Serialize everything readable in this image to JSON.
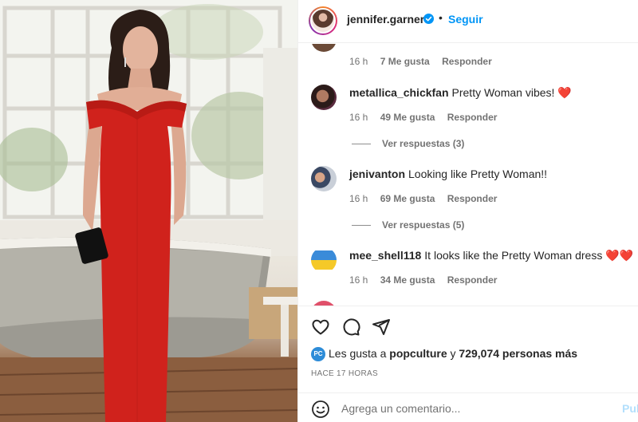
{
  "post": {
    "username": "jennifer.garner",
    "follow_label": "Seguir",
    "separator": "•"
  },
  "comments": {
    "top_meta": {
      "time": "16 h",
      "likes": "7 Me gusta",
      "reply": "Responder"
    },
    "items": [
      {
        "username": "metallica_chickfan",
        "text": "Pretty Woman vibes! ❤️",
        "time": "16 h",
        "likes": "49 Me gusta",
        "reply": "Responder",
        "replies": "Ver respuestas (3)"
      },
      {
        "username": "jenivanton",
        "text": "Looking like Pretty Woman!!",
        "time": "16 h",
        "likes": "69 Me gusta",
        "reply": "Responder",
        "replies": "Ver respuestas (5)"
      },
      {
        "username": "mee_shell118",
        "text": "It looks like the Pretty Woman dress ❤️❤️",
        "time": "16 h",
        "likes": "34 Me gusta",
        "reply": "Responder"
      }
    ]
  },
  "actions": {
    "like_icon": "heart-icon",
    "comment_icon": "comment-icon",
    "share_icon": "send-icon"
  },
  "likes": {
    "badge": "PC",
    "prefix": "Les gusta a",
    "user": "popculture",
    "connector": "y",
    "others": "729,074 personas más"
  },
  "timestamp": "HACE 17 HORAS",
  "add_comment": {
    "placeholder": "Agrega un comentario...",
    "post_label": "Publicar",
    "emoji_icon": "emoji-icon"
  },
  "colors": {
    "accent": "#0095f6",
    "muted": "#737373",
    "dress": "#d0221c"
  }
}
